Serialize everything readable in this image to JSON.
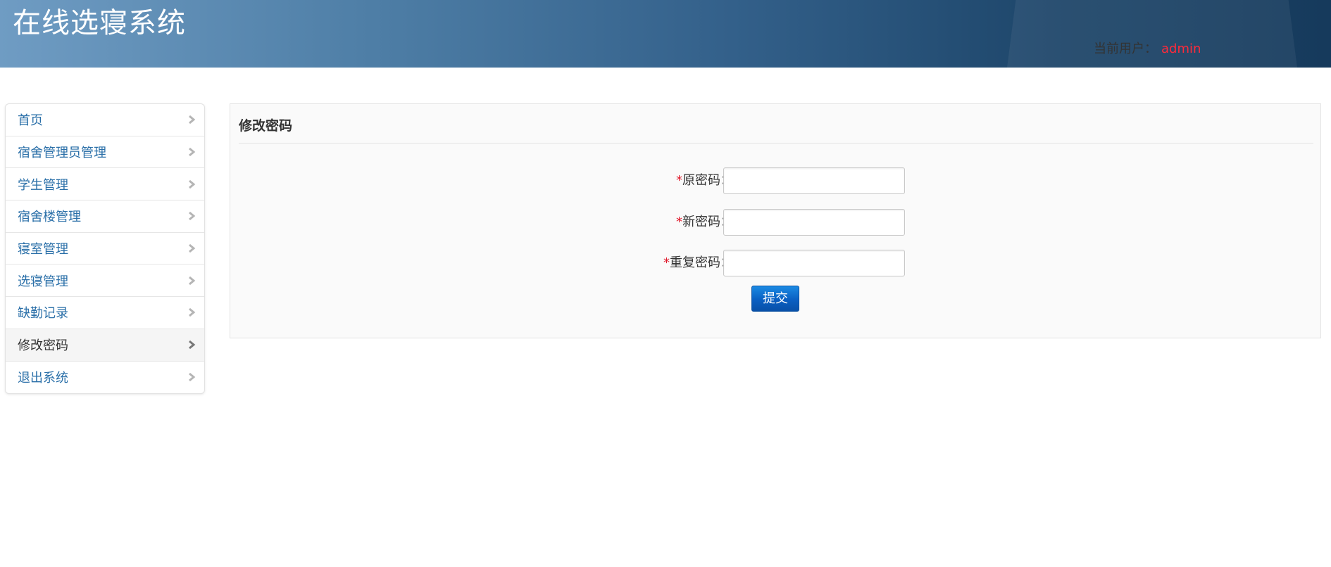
{
  "header": {
    "app_title": "在线选寝系统",
    "current_user_label": "当前用户：",
    "current_user_name": "admin"
  },
  "sidebar": {
    "items": [
      {
        "label": "首页",
        "icon": "chevron-right-icon",
        "active": false
      },
      {
        "label": "宿舍管理员管理",
        "icon": "chevron-right-icon",
        "active": false
      },
      {
        "label": "学生管理",
        "icon": "chevron-right-icon",
        "active": false
      },
      {
        "label": "宿舍楼管理",
        "icon": "chevron-right-icon",
        "active": false
      },
      {
        "label": "寝室管理",
        "icon": "chevron-right-icon",
        "active": false
      },
      {
        "label": "选寝管理",
        "icon": "chevron-right-icon",
        "active": false
      },
      {
        "label": "缺勤记录",
        "icon": "chevron-right-icon",
        "active": false
      },
      {
        "label": "修改密码",
        "icon": "chevron-right-icon",
        "active": true
      },
      {
        "label": "退出系统",
        "icon": "chevron-right-icon",
        "active": false
      }
    ]
  },
  "main": {
    "panel_title": "修改密码",
    "required_mark": "*",
    "fields": {
      "old_password": {
        "label": "原密码：",
        "value": ""
      },
      "new_password": {
        "label": "新密码：",
        "value": ""
      },
      "repeat_password": {
        "label": "重复密码：",
        "value": ""
      }
    },
    "submit_label": "提交"
  },
  "colors": {
    "header_gradient_start": "#6f9cc3",
    "header_gradient_end": "#163a5c",
    "nav_link": "#2a6fa8",
    "required": "#e0182a",
    "user_name": "#ff2a3a",
    "button": "#0a5fc2"
  }
}
